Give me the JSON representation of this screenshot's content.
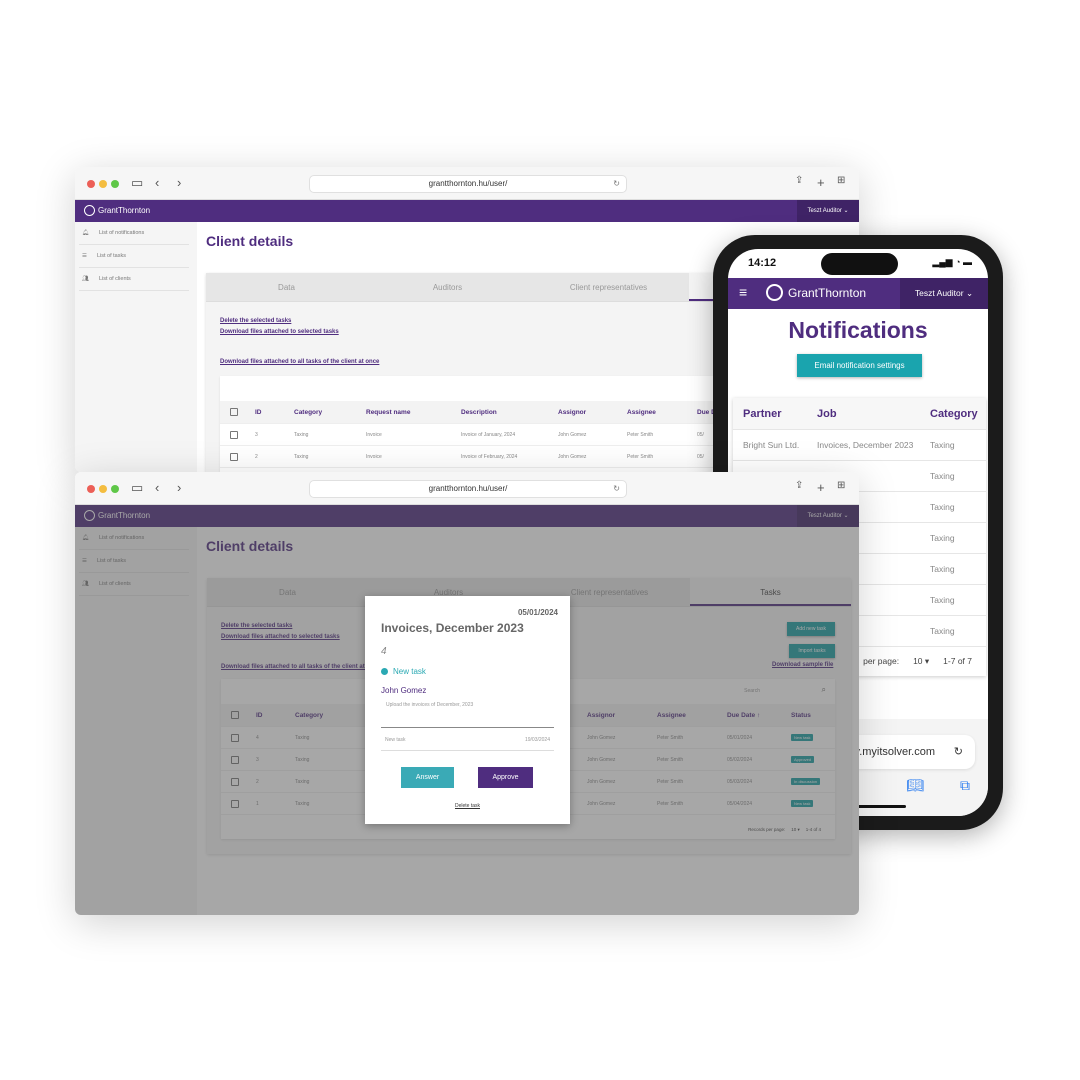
{
  "browser": {
    "url": "grantthornton.hu/user/",
    "brand": "GrantThornton",
    "user": "Teszt Auditor"
  },
  "sidebar": {
    "items": [
      {
        "label": "List of notifications",
        "icon": "bell-icon"
      },
      {
        "label": "List of tasks",
        "icon": "list-icon"
      },
      {
        "label": "List of clients",
        "icon": "people-icon"
      }
    ]
  },
  "page": {
    "title": "Client details",
    "tabs": [
      "Data",
      "Auditors",
      "Client representatives",
      "Tasks"
    ],
    "links": {
      "delete": "Delete the selected tasks",
      "download_selected": "Download files attached to selected tasks",
      "download_all": "Download files attached to all tasks of the client at once",
      "sample": "Download sample file"
    },
    "buttons": {
      "add": "Add new task",
      "import": "Import tasks"
    },
    "search_placeholder": "Search",
    "columns": [
      "ID",
      "Category",
      "Request name",
      "Description",
      "Assignor",
      "Assignee",
      "Due Date",
      "Status"
    ],
    "back_rows": [
      {
        "id": "3",
        "category": "Taxing",
        "request": "Invoice",
        "description": "Invoice of January, 2024",
        "assignor": "John Gomez",
        "assignee": "Peter Smith",
        "due": "05/"
      },
      {
        "id": "2",
        "category": "Taxing",
        "request": "Invoice",
        "description": "Invoice of February, 2024",
        "assignor": "John Gomez",
        "assignee": "Peter Smith",
        "due": "05/"
      }
    ],
    "rows": [
      {
        "id": "4",
        "category": "Taxing",
        "assignor": "John Gomez",
        "assignee": "Peter Smith",
        "due": "05/01/2024",
        "status": "New task"
      },
      {
        "id": "3",
        "category": "Taxing",
        "assignor": "John Gomez",
        "assignee": "Peter Smith",
        "due": "05/02/2024",
        "status": "Approved"
      },
      {
        "id": "2",
        "category": "Taxing",
        "assignor": "John Gomez",
        "assignee": "Peter Smith",
        "due": "05/03/2024",
        "status": "In discussion"
      },
      {
        "id": "1",
        "category": "Taxing",
        "assignor": "John Gomez",
        "assignee": "Peter Smith",
        "due": "05/04/2024",
        "status": "New task"
      }
    ],
    "pagination": {
      "label": "Records per page:",
      "per_page": "10",
      "range": "1-4 of 4"
    }
  },
  "modal": {
    "date": "05/01/2024",
    "title": "Invoices, December 2023",
    "number": "4",
    "status": "New task",
    "person": "John Gomez",
    "description": "Upload the invoices of December, 2023",
    "history_label": "New task",
    "history_date": "19/03/2024",
    "answer": "Answer",
    "approve": "Approve",
    "delete": "Delete task"
  },
  "phone": {
    "time": "14:12",
    "brand": "GrantThornton",
    "user": "Teszt Auditor",
    "title": "Notifications",
    "email_btn": "Email notification settings",
    "columns": [
      "Partner",
      "Job",
      "Category"
    ],
    "rows": [
      {
        "partner": "Bright Sun Ltd.",
        "job": "Invoices, December 2023",
        "category": "Taxing"
      },
      {
        "partner": "",
        "job": "",
        "category": "Taxing"
      },
      {
        "partner": "",
        "job": "",
        "category": "Taxing"
      },
      {
        "partner": "",
        "job": "",
        "category": "Taxing"
      },
      {
        "partner": "",
        "job": "",
        "category": "Taxing"
      },
      {
        "partner": "",
        "job": "",
        "category": "Taxing"
      },
      {
        "partner": "",
        "job": "",
        "category": "Taxing"
      }
    ],
    "pagination": {
      "label": "per page:",
      "per_page": "10",
      "range": "1-7 of 7"
    },
    "url": "ev.myitsolver.com"
  },
  "colors": {
    "brand": "#4f2d7f",
    "accent": "#1a9ea2"
  }
}
